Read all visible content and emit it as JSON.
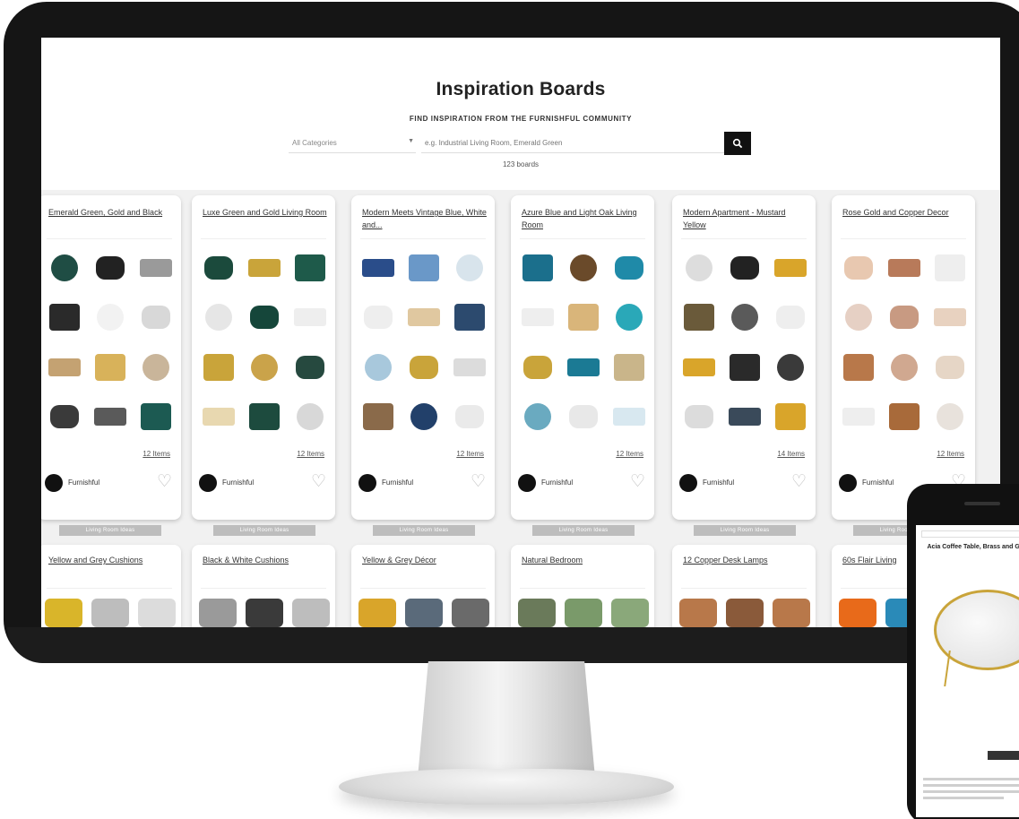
{
  "page": {
    "title": "Inspiration Boards",
    "subtitle": "FIND INSPIRATION FROM THE FURNISHFUL COMMUNITY",
    "board_count": "123 boards"
  },
  "search": {
    "category_label": "All Categories",
    "placeholder": "e.g. Industrial Living Room, Emerald Green"
  },
  "boards": [
    {
      "title": "Emerald Green, Gold and Black",
      "items": "12 Items",
      "author": "Furnishful",
      "tag": "Living Room Ideas",
      "thumbs": [
        "#1f4d44",
        "#222222",
        "#9a9a9a",
        "#2a2a2a",
        "#f2f2f2",
        "#d8d8d8",
        "#c4a272",
        "#d8b25a",
        "#c9b59a",
        "#3a3a3a",
        "#5a5a5a",
        "#1c5a52"
      ]
    },
    {
      "title": "Luxe Green and Gold Living Room",
      "items": "12 Items",
      "author": "Furnishful",
      "tag": "Living Room Ideas",
      "thumbs": [
        "#1b4a3c",
        "#c9a43a",
        "#1e5a4a",
        "#e6e6e6",
        "#15463a",
        "#eeeeee",
        "#c9a43a",
        "#caa34a",
        "#26493f",
        "#e8d8b0",
        "#1d4b3e",
        "#d8d8d8"
      ]
    },
    {
      "title": "Modern Meets Vintage Blue, White and...",
      "items": "12 Items",
      "author": "Furnishful",
      "tag": "Living Room Ideas",
      "thumbs": [
        "#2a4d8a",
        "#6a98c8",
        "#d8e4ec",
        "#eeeeee",
        "#e0c8a0",
        "#2c4a6e",
        "#a8c8dc",
        "#c9a43a",
        "#dcdcdc",
        "#8a6a4a",
        "#22406a",
        "#eaeaea"
      ]
    },
    {
      "title": "Azure Blue and Light Oak Living Room",
      "items": "12 Items",
      "author": "Furnishful",
      "tag": "Living Room Ideas",
      "thumbs": [
        "#1b6f8c",
        "#6a4a2a",
        "#1f8aa8",
        "#eeeeee",
        "#d9b57a",
        "#2aa8b8",
        "#c9a43a",
        "#1b7a94",
        "#c9b58a",
        "#6aaac0",
        "#e8e8e8",
        "#d8e8f0"
      ]
    },
    {
      "title": "Modern Apartment - Mustard Yellow",
      "items": "14 Items",
      "author": "Furnishful",
      "tag": "Living Room Ideas",
      "thumbs": [
        "#dddddd",
        "#222222",
        "#d9a52a",
        "#6a5a3a",
        "#5a5a5a",
        "#eeeeee",
        "#d9a52a",
        "#2a2a2a",
        "#3a3a3a",
        "#dcdcdc",
        "#3a4a5a",
        "#d9a52a"
      ]
    },
    {
      "title": "Rose Gold and Copper Decor",
      "items": "12 Items",
      "author": "Furnishful",
      "tag": "Living Room Ideas",
      "thumbs": [
        "#e8c8b0",
        "#b87a5a",
        "#eeeeee",
        "#e6d0c4",
        "#c89a82",
        "#e8d2c0",
        "#b8784a",
        "#d0a890",
        "#e6d6c6",
        "#eeeeee",
        "#a86a3a",
        "#e8e2dc"
      ]
    }
  ],
  "boards_row2": [
    {
      "title": "Yellow and Grey Cushions",
      "thumbs": [
        "#d9b52a",
        "#bdbdbd",
        "#dcdcdc"
      ]
    },
    {
      "title": "Black & White Cushions",
      "thumbs": [
        "#9a9a9a",
        "#3a3a3a",
        "#bdbdbd"
      ]
    },
    {
      "title": "Yellow & Grey Décor",
      "thumbs": [
        "#d9a52a",
        "#5a6a7a",
        "#6a6a6a"
      ]
    },
    {
      "title": "Natural Bedroom",
      "thumbs": [
        "#6a7a5a",
        "#7a9a6a",
        "#8aa87a"
      ]
    },
    {
      "title": "12 Copper Desk Lamps",
      "thumbs": [
        "#b8784a",
        "#8a5a3a",
        "#b8784a"
      ]
    },
    {
      "title": "60s Flair Living",
      "thumbs": [
        "#e86a1a",
        "#2a8ab8",
        "#dcdcdc"
      ]
    }
  ],
  "phone": {
    "title": "Acia Coffee Table, Brass and Glass"
  }
}
